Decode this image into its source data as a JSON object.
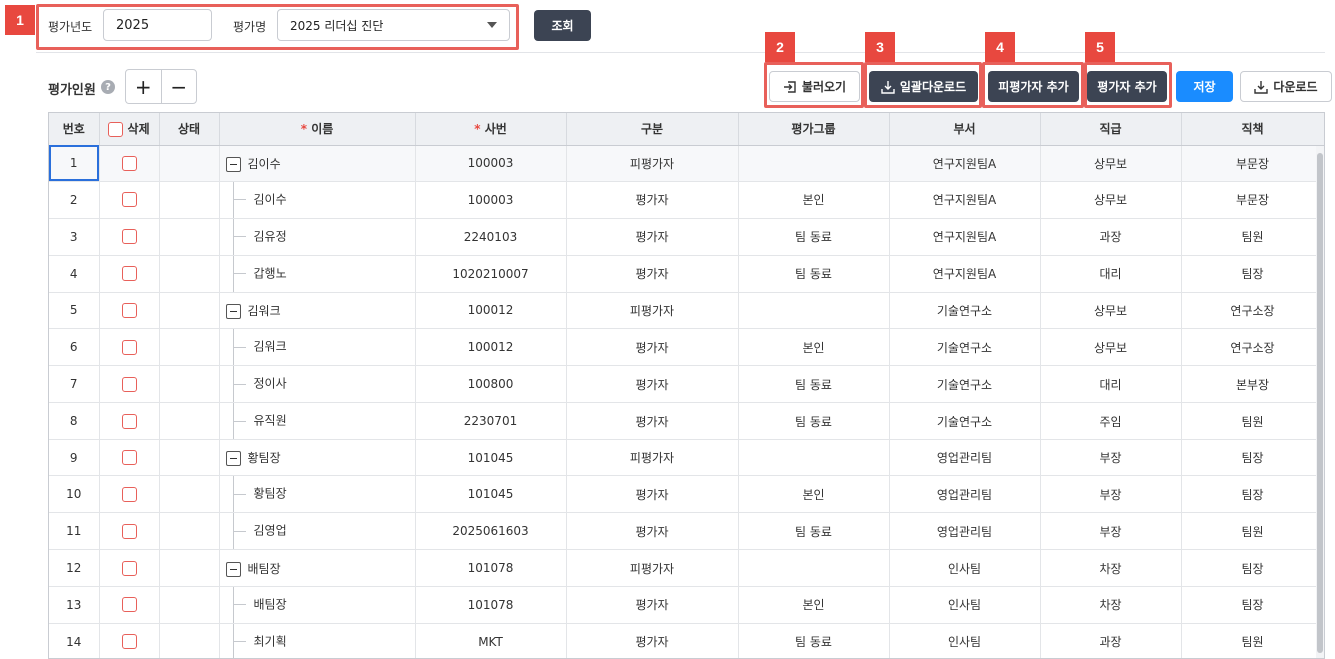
{
  "badges": [
    "1",
    "2",
    "3",
    "4",
    "5"
  ],
  "filter": {
    "year_label": "평가년도",
    "year_value": "2025",
    "name_label": "평가명",
    "name_value": "2025 리더십 진단",
    "search_label": "조회"
  },
  "section": {
    "title": "평가인원",
    "help": "?",
    "add": "+",
    "remove": "−"
  },
  "toolbar": {
    "load_label": "불러오기",
    "bulk_download_label": "일괄다운로드",
    "add_evaluatee_label": "피평가자 추가",
    "add_evaluator_label": "평가자 추가",
    "save_label": "저장",
    "download_label": "다운로드"
  },
  "colors": {
    "badge": "#e8483f",
    "dark_button": "#3c4453",
    "save_button": "#1a8cff",
    "selection": "#2a6fdb"
  },
  "grid": {
    "columns": [
      "번호",
      "삭제",
      "상태",
      "이름",
      "사번",
      "구분",
      "평가그룹",
      "부서",
      "직급",
      "직책"
    ],
    "required_mark": "*",
    "rows": [
      {
        "no": "1",
        "name": "김이수",
        "level": 0,
        "id": "100003",
        "type": "피평가자",
        "group": "",
        "dept": "연구지원팀A",
        "rank": "상무보",
        "title": "부문장"
      },
      {
        "no": "2",
        "name": "김이수",
        "level": 1,
        "id": "100003",
        "type": "평가자",
        "group": "본인",
        "dept": "연구지원팀A",
        "rank": "상무보",
        "title": "부문장"
      },
      {
        "no": "3",
        "name": "김유정",
        "level": 1,
        "id": "2240103",
        "type": "평가자",
        "group": "팀 동료",
        "dept": "연구지원팀A",
        "rank": "과장",
        "title": "팀원"
      },
      {
        "no": "4",
        "name": "갑행노",
        "level": 1,
        "id": "1020210007",
        "type": "평가자",
        "group": "팀 동료",
        "dept": "연구지원팀A",
        "rank": "대리",
        "title": "팀장"
      },
      {
        "no": "5",
        "name": "김워크",
        "level": 0,
        "id": "100012",
        "type": "피평가자",
        "group": "",
        "dept": "기술연구소",
        "rank": "상무보",
        "title": "연구소장"
      },
      {
        "no": "6",
        "name": "김워크",
        "level": 1,
        "id": "100012",
        "type": "평가자",
        "group": "본인",
        "dept": "기술연구소",
        "rank": "상무보",
        "title": "연구소장"
      },
      {
        "no": "7",
        "name": "정이사",
        "level": 1,
        "id": "100800",
        "type": "평가자",
        "group": "팀 동료",
        "dept": "기술연구소",
        "rank": "대리",
        "title": "본부장"
      },
      {
        "no": "8",
        "name": "유직원",
        "level": 1,
        "id": "2230701",
        "type": "평가자",
        "group": "팀 동료",
        "dept": "기술연구소",
        "rank": "주임",
        "title": "팀원"
      },
      {
        "no": "9",
        "name": "황팀장",
        "level": 0,
        "id": "101045",
        "type": "피평가자",
        "group": "",
        "dept": "영업관리팀",
        "rank": "부장",
        "title": "팀장"
      },
      {
        "no": "10",
        "name": "황팀장",
        "level": 1,
        "id": "101045",
        "type": "평가자",
        "group": "본인",
        "dept": "영업관리팀",
        "rank": "부장",
        "title": "팀장"
      },
      {
        "no": "11",
        "name": "김영업",
        "level": 1,
        "id": "2025061603",
        "type": "평가자",
        "group": "팀 동료",
        "dept": "영업관리팀",
        "rank": "부장",
        "title": "팀원"
      },
      {
        "no": "12",
        "name": "배팀장",
        "level": 0,
        "id": "101078",
        "type": "피평가자",
        "group": "",
        "dept": "인사팀",
        "rank": "차장",
        "title": "팀장"
      },
      {
        "no": "13",
        "name": "배팀장",
        "level": 1,
        "id": "101078",
        "type": "평가자",
        "group": "본인",
        "dept": "인사팀",
        "rank": "차장",
        "title": "팀장"
      },
      {
        "no": "14",
        "name": "최기획",
        "level": 1,
        "id": "MKT",
        "type": "평가자",
        "group": "팀 동료",
        "dept": "인사팀",
        "rank": "과장",
        "title": "팀원"
      }
    ]
  }
}
